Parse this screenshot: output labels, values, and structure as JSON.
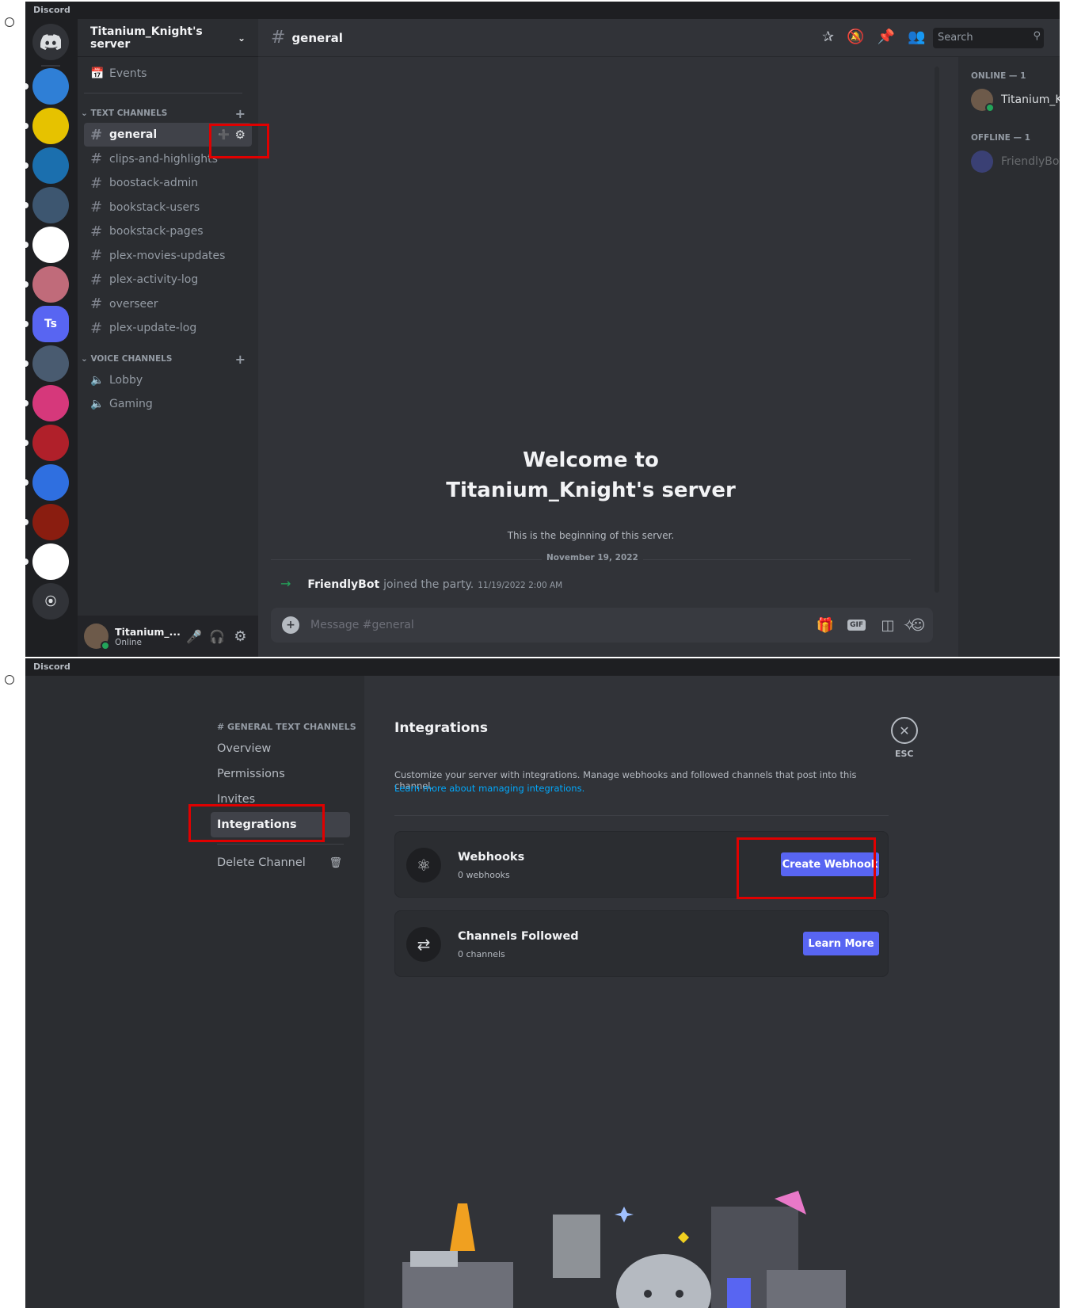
{
  "app_name": "Discord",
  "screen1": {
    "server_name": "Titanium_Knight's server",
    "servers": [
      {
        "name": "server-1",
        "color": "#2f7fd6"
      },
      {
        "name": "server-2",
        "color": "#e6c200"
      },
      {
        "name": "server-3",
        "color": "#1b6fae"
      },
      {
        "name": "server-4",
        "color": "#3d5670"
      },
      {
        "name": "server-5",
        "color": "#ffffff"
      },
      {
        "name": "server-6",
        "color": "#c06b7a"
      },
      {
        "name": "Ts",
        "color": "#5865f2"
      },
      {
        "name": "server-8",
        "color": "#495b70"
      },
      {
        "name": "server-9",
        "color": "#d6387b"
      },
      {
        "name": "server-10",
        "color": "#b0202a"
      },
      {
        "name": "server-11",
        "color": "#2f6fe0"
      },
      {
        "name": "server-12",
        "color": "#8a1d10"
      },
      {
        "name": "server-13",
        "color": "#ffffff"
      }
    ],
    "events_label": "Events",
    "text_category": "TEXT CHANNELS",
    "voice_category": "VOICE CHANNELS",
    "text_channels": [
      "general",
      "clips-and-highlights",
      "boostack-admin",
      "bookstack-users",
      "bookstack-pages",
      "plex-movies-updates",
      "plex-activity-log",
      "overseer",
      "plex-update-log"
    ],
    "voice_channels": [
      "Lobby",
      "Gaming"
    ],
    "current_channel": "general",
    "search_placeholder": "Search",
    "members": {
      "online_header": "ONLINE — 1",
      "offline_header": "OFFLINE — 1",
      "online_user": "Titanium_K",
      "offline_user": "FriendlyBot"
    },
    "welcome_line1": "Welcome to",
    "welcome_line2": "Titanium_Knight's server",
    "welcome_sub": "This is the beginning of this server.",
    "date_divider": "November 19, 2022",
    "join_message": {
      "user": "FriendlyBot",
      "text": "joined the party.",
      "timestamp": "11/19/2022 2:00 AM"
    },
    "message_placeholder": "Message #general",
    "user_panel": {
      "name": "Titanium_...",
      "status": "Online"
    }
  },
  "screen2": {
    "nav_header": "# GENERAL TEXT CHANNELS",
    "nav_items": [
      "Overview",
      "Permissions",
      "Invites",
      "Integrations"
    ],
    "delete_label": "Delete Channel",
    "page_title": "Integrations",
    "description": "Customize your server with integrations. Manage webhooks and followed channels that post into this channel.",
    "learn_link": "Learn more about managing integrations.",
    "esc_label": "ESC",
    "webhooks": {
      "title": "Webhooks",
      "sub": "0 webhooks",
      "button": "Create Webhook"
    },
    "channels_followed": {
      "title": "Channels Followed",
      "sub": "0 channels",
      "button": "Learn More"
    }
  },
  "colors": {
    "accent": "#5865f2",
    "highlight_box": "#e00000",
    "online": "#23a55a",
    "link": "#00a8fc"
  }
}
